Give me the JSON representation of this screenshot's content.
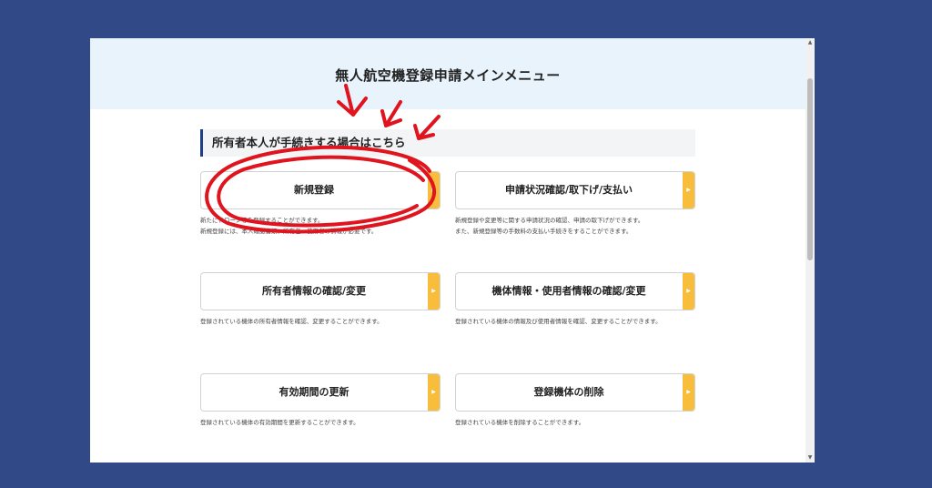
{
  "page": {
    "title": "無人航空機登録申請メインメニュー",
    "section_heading": "所有者本人が手続きする場合はこちら"
  },
  "menu": [
    {
      "label": "新規登録",
      "arrow": "▶",
      "desc": [
        "新たにドローン等を登録することができます。",
        "新規登録には、本人確認書類、所有者・使用者の情報が必要です。"
      ]
    },
    {
      "label": "申請状況確認/取下げ/支払い",
      "arrow": "▶",
      "desc": [
        "新規登録や変更等に関する申請状況の確認、申請の取下げができます。",
        "また、新規登録等の手数料の支払い手続きをすることができます。"
      ]
    },
    {
      "label": "所有者情報の確認/変更",
      "arrow": "▶",
      "desc": [
        "登録されている機体の所有者情報を確認、変更することができます。"
      ]
    },
    {
      "label": "機体情報・使用者情報の確認/変更",
      "arrow": "▶",
      "desc": [
        "登録されている機体の情報及び使用者情報を確認、変更することができます。"
      ]
    },
    {
      "label": "有効期間の更新",
      "arrow": "▶",
      "desc": [
        "登録されている機体の有効期間を更新することができます。"
      ]
    },
    {
      "label": "登録機体の削除",
      "arrow": "▶",
      "desc": [
        "登録されている機体を削除することができます。"
      ]
    }
  ],
  "scrollbar": {
    "up": "▲",
    "down": "▼"
  },
  "colors": {
    "background": "#314a87",
    "header_band": "#e8f3fc",
    "accent_arrow": "#f7bd3b",
    "section_bar": "#1f3f86",
    "annotation": "#e0141e"
  }
}
